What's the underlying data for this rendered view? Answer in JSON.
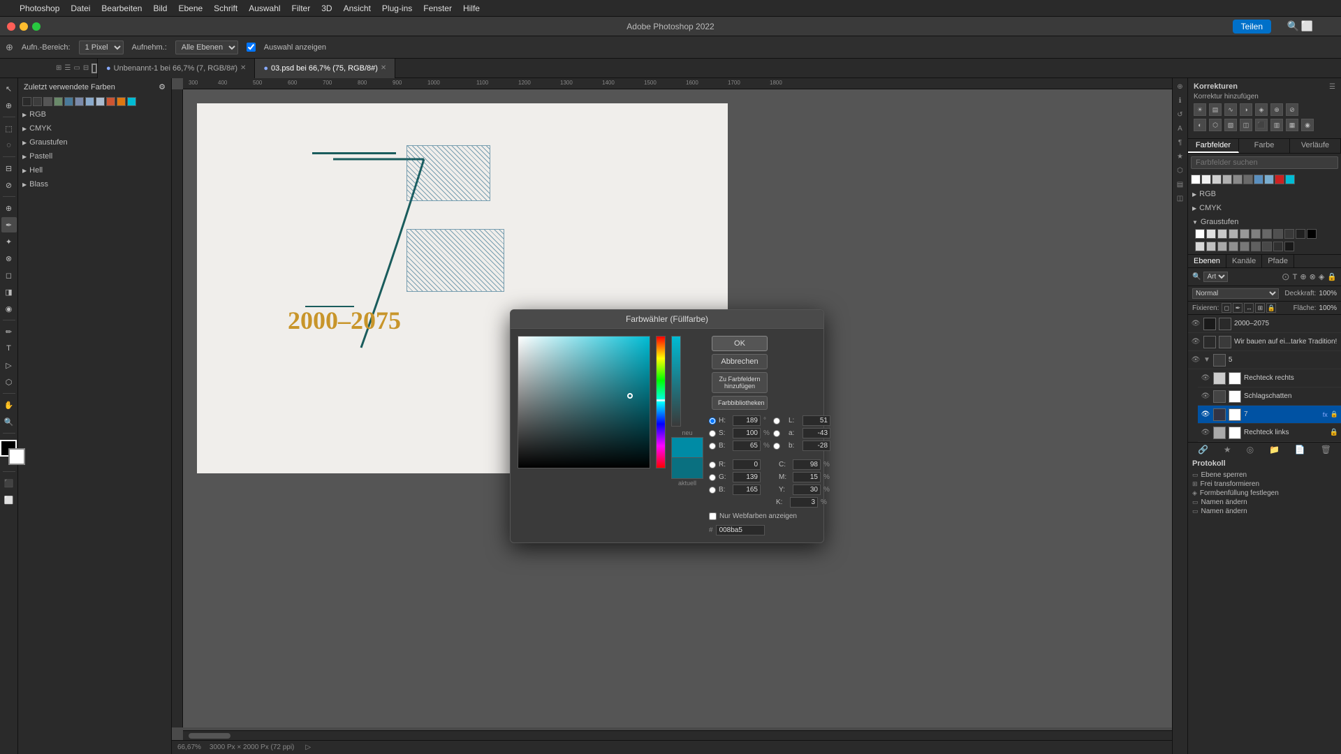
{
  "app": {
    "title": "Adobe Photoshop 2022",
    "apple_symbol": ""
  },
  "menubar": {
    "items": [
      "Datei",
      "Bearbeiten",
      "Bild",
      "Ebene",
      "Schrift",
      "Auswahl",
      "Filter",
      "3D",
      "Ansicht",
      "Plug-ins",
      "Fenster",
      "Hilfe"
    ]
  },
  "options_bar": {
    "aufn_bereich_label": "Aufn.-Bereich:",
    "aufn_bereich_value": "1 Pixel",
    "aufnehmen_label": "Aufnehm.:",
    "aufnehmen_value": "Alle Ebenen",
    "auswahl_label": "Auswahl anzeigen"
  },
  "tabs": [
    {
      "label": "Unbenannt-1 bei 66,7% (7, RGB/8#)",
      "active": false,
      "modified": true
    },
    {
      "label": "03.psd bei 66,7% (75, RGB/8#)",
      "active": true,
      "modified": true
    }
  ],
  "left_tools": [
    "✦",
    "⊕",
    "⌧",
    "⊡",
    "✂",
    "⋮",
    "✒",
    "✐",
    "⟆",
    "🖌",
    "⬡",
    "♦",
    "✏",
    "🔍",
    "🤚",
    "🔲",
    "◎"
  ],
  "swatch_panel": {
    "title": "Zuletzt verwendete Farben",
    "groups": [
      "RGB",
      "CMYK",
      "Graustufen",
      "Pastell",
      "Hell",
      "Blass"
    ]
  },
  "correctors_panel": {
    "title": "Korrekturen",
    "subtitle": "Korrektur hinzufügen"
  },
  "farbfelder_panel": {
    "tabs": [
      "Farbfelder",
      "Farbe",
      "Verläufe"
    ],
    "search_placeholder": "Farbfelder suchen",
    "groups": {
      "rgb": "RGB",
      "cmyk": "CMYK",
      "graustufen": "Graustufen"
    }
  },
  "layers_panel": {
    "tabs": [
      "Ebenen",
      "Kanäle",
      "Pfade"
    ],
    "filter_label": "Art",
    "blend_mode": "Normal",
    "opacity_label": "Deckkraft:",
    "opacity_value": "100%",
    "fixieren_label": "Fixieren:",
    "flaeche_label": "Fläche:",
    "flaeche_value": "100%",
    "layers": [
      {
        "name": "2000–2075",
        "type": "text",
        "visible": true,
        "active": false,
        "indent": 0
      },
      {
        "name": "Wir bauen auf ei...tarke Tradition!",
        "type": "text",
        "visible": true,
        "active": false,
        "indent": 0
      },
      {
        "name": "5",
        "type": "group",
        "visible": true,
        "active": false,
        "indent": 0
      },
      {
        "name": "Rechteck rechts",
        "type": "rect",
        "visible": true,
        "active": false,
        "indent": 1
      },
      {
        "name": "Schlagschatten",
        "type": "effect",
        "visible": true,
        "active": false,
        "indent": 1
      },
      {
        "name": "7",
        "type": "text",
        "visible": true,
        "active": true,
        "indent": 1,
        "has_fx": true
      },
      {
        "name": "Rechteck links",
        "type": "rect",
        "visible": true,
        "active": false,
        "indent": 1
      }
    ]
  },
  "protocol_panel": {
    "title": "Protokoll",
    "items": [
      "Ebene sperren",
      "Frei transformieren",
      "Formbenfüllung festlegen",
      "Namen ändern",
      "Namen ändern"
    ]
  },
  "color_picker": {
    "title": "Farbwähler (Füllfarbe)",
    "btn_ok": "OK",
    "btn_cancel": "Abbrechen",
    "btn_add_swatch": "Zu Farbfeldern hinzufügen",
    "btn_libraries": "Farbbibliotheken",
    "label_new": "neu",
    "label_current": "aktuell",
    "h_label": "H:",
    "h_value": "189",
    "h_unit": "°",
    "s_label": "S:",
    "s_value": "100",
    "s_unit": "%",
    "b_label": "B:",
    "b_value": "65",
    "b_unit": "%",
    "r_label": "R:",
    "r_value": "0",
    "g_label": "G:",
    "g_value": "139",
    "b2_label": "B:",
    "b2_value": "165",
    "L_label": "L:",
    "L_value": "51",
    "a_label": "a:",
    "a_value": "-43",
    "b3_label": "b:",
    "b3_value": "-28",
    "C_label": "C:",
    "C_value": "98",
    "C_unit": "%",
    "M_label": "M:",
    "M_value": "15",
    "M_unit": "%",
    "Y_label": "Y:",
    "Y_value": "30",
    "Y_unit": "%",
    "K_label": "K:",
    "K_value": "3",
    "K_unit": "%",
    "web_only_label": "Nur Webfarben anzeigen",
    "hex_value": "#008ba5"
  },
  "canvas": {
    "text_2000": "2000–2075",
    "zoom": "66,67%",
    "dimensions": "3000 Px × 2000 Px (72 ppi)"
  },
  "share_btn": "Teilen"
}
